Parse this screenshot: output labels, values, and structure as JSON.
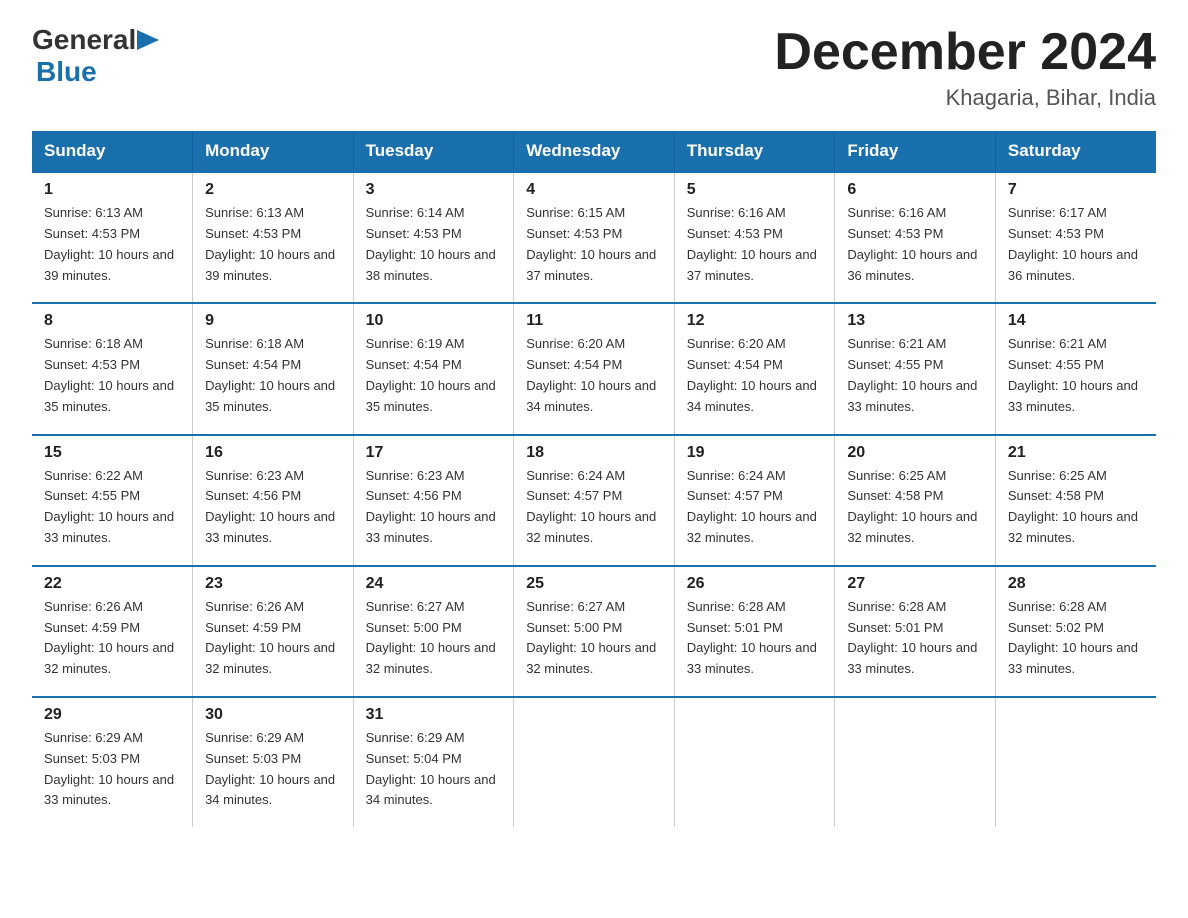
{
  "logo": {
    "general": "General",
    "blue": "Blue"
  },
  "title": {
    "month_year": "December 2024",
    "location": "Khagaria, Bihar, India"
  },
  "days_of_week": [
    "Sunday",
    "Monday",
    "Tuesday",
    "Wednesday",
    "Thursday",
    "Friday",
    "Saturday"
  ],
  "weeks": [
    [
      {
        "day": "1",
        "sunrise": "6:13 AM",
        "sunset": "4:53 PM",
        "daylight": "10 hours and 39 minutes."
      },
      {
        "day": "2",
        "sunrise": "6:13 AM",
        "sunset": "4:53 PM",
        "daylight": "10 hours and 39 minutes."
      },
      {
        "day": "3",
        "sunrise": "6:14 AM",
        "sunset": "4:53 PM",
        "daylight": "10 hours and 38 minutes."
      },
      {
        "day": "4",
        "sunrise": "6:15 AM",
        "sunset": "4:53 PM",
        "daylight": "10 hours and 37 minutes."
      },
      {
        "day": "5",
        "sunrise": "6:16 AM",
        "sunset": "4:53 PM",
        "daylight": "10 hours and 37 minutes."
      },
      {
        "day": "6",
        "sunrise": "6:16 AM",
        "sunset": "4:53 PM",
        "daylight": "10 hours and 36 minutes."
      },
      {
        "day": "7",
        "sunrise": "6:17 AM",
        "sunset": "4:53 PM",
        "daylight": "10 hours and 36 minutes."
      }
    ],
    [
      {
        "day": "8",
        "sunrise": "6:18 AM",
        "sunset": "4:53 PM",
        "daylight": "10 hours and 35 minutes."
      },
      {
        "day": "9",
        "sunrise": "6:18 AM",
        "sunset": "4:54 PM",
        "daylight": "10 hours and 35 minutes."
      },
      {
        "day": "10",
        "sunrise": "6:19 AM",
        "sunset": "4:54 PM",
        "daylight": "10 hours and 35 minutes."
      },
      {
        "day": "11",
        "sunrise": "6:20 AM",
        "sunset": "4:54 PM",
        "daylight": "10 hours and 34 minutes."
      },
      {
        "day": "12",
        "sunrise": "6:20 AM",
        "sunset": "4:54 PM",
        "daylight": "10 hours and 34 minutes."
      },
      {
        "day": "13",
        "sunrise": "6:21 AM",
        "sunset": "4:55 PM",
        "daylight": "10 hours and 33 minutes."
      },
      {
        "day": "14",
        "sunrise": "6:21 AM",
        "sunset": "4:55 PM",
        "daylight": "10 hours and 33 minutes."
      }
    ],
    [
      {
        "day": "15",
        "sunrise": "6:22 AM",
        "sunset": "4:55 PM",
        "daylight": "10 hours and 33 minutes."
      },
      {
        "day": "16",
        "sunrise": "6:23 AM",
        "sunset": "4:56 PM",
        "daylight": "10 hours and 33 minutes."
      },
      {
        "day": "17",
        "sunrise": "6:23 AM",
        "sunset": "4:56 PM",
        "daylight": "10 hours and 33 minutes."
      },
      {
        "day": "18",
        "sunrise": "6:24 AM",
        "sunset": "4:57 PM",
        "daylight": "10 hours and 32 minutes."
      },
      {
        "day": "19",
        "sunrise": "6:24 AM",
        "sunset": "4:57 PM",
        "daylight": "10 hours and 32 minutes."
      },
      {
        "day": "20",
        "sunrise": "6:25 AM",
        "sunset": "4:58 PM",
        "daylight": "10 hours and 32 minutes."
      },
      {
        "day": "21",
        "sunrise": "6:25 AM",
        "sunset": "4:58 PM",
        "daylight": "10 hours and 32 minutes."
      }
    ],
    [
      {
        "day": "22",
        "sunrise": "6:26 AM",
        "sunset": "4:59 PM",
        "daylight": "10 hours and 32 minutes."
      },
      {
        "day": "23",
        "sunrise": "6:26 AM",
        "sunset": "4:59 PM",
        "daylight": "10 hours and 32 minutes."
      },
      {
        "day": "24",
        "sunrise": "6:27 AM",
        "sunset": "5:00 PM",
        "daylight": "10 hours and 32 minutes."
      },
      {
        "day": "25",
        "sunrise": "6:27 AM",
        "sunset": "5:00 PM",
        "daylight": "10 hours and 32 minutes."
      },
      {
        "day": "26",
        "sunrise": "6:28 AM",
        "sunset": "5:01 PM",
        "daylight": "10 hours and 33 minutes."
      },
      {
        "day": "27",
        "sunrise": "6:28 AM",
        "sunset": "5:01 PM",
        "daylight": "10 hours and 33 minutes."
      },
      {
        "day": "28",
        "sunrise": "6:28 AM",
        "sunset": "5:02 PM",
        "daylight": "10 hours and 33 minutes."
      }
    ],
    [
      {
        "day": "29",
        "sunrise": "6:29 AM",
        "sunset": "5:03 PM",
        "daylight": "10 hours and 33 minutes."
      },
      {
        "day": "30",
        "sunrise": "6:29 AM",
        "sunset": "5:03 PM",
        "daylight": "10 hours and 34 minutes."
      },
      {
        "day": "31",
        "sunrise": "6:29 AM",
        "sunset": "5:04 PM",
        "daylight": "10 hours and 34 minutes."
      },
      null,
      null,
      null,
      null
    ]
  ],
  "labels": {
    "sunrise": "Sunrise:",
    "sunset": "Sunset:",
    "daylight": "Daylight:"
  }
}
